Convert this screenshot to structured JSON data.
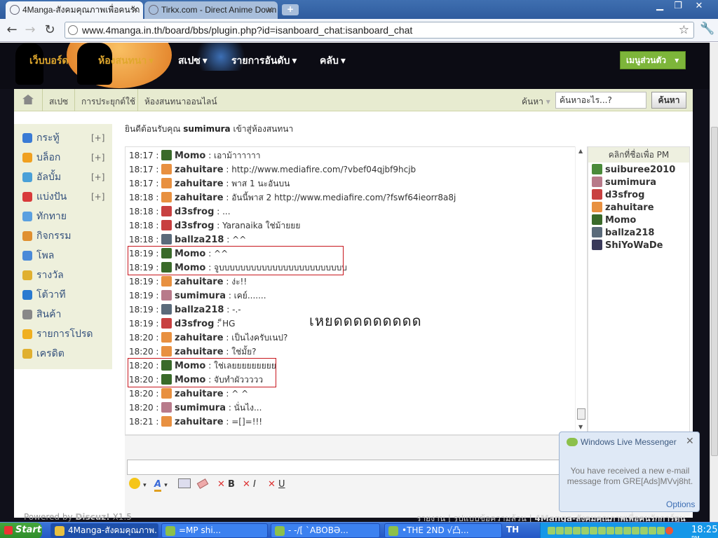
{
  "browser": {
    "tabs": [
      {
        "label": "4Manga-สังคมคุณภาพเพื่อคนรัก",
        "active": true
      },
      {
        "label": "Tirkx.com - Direct Anime Down",
        "active": false
      }
    ],
    "url": "www.4manga.in.th/board/bbs/plugin.php?id=isanboard_chat:isanboard_chat",
    "nav_icons": [
      "back-icon",
      "forward-icon",
      "reload-icon",
      "star-icon",
      "wrench-icon"
    ]
  },
  "site": {
    "main_nav": [
      {
        "label": "เว็บบอร์ด",
        "color": "#e0a82e",
        "dropdown": false
      },
      {
        "label": "ห้องสนทนา",
        "color": "#e0a82e",
        "dropdown": true
      },
      {
        "label": "สเปซ",
        "color": "#ffffff",
        "dropdown": true
      },
      {
        "label": "รายการอันดับ",
        "color": "#ffffff",
        "dropdown": true
      },
      {
        "label": "คลับ",
        "color": "#ffffff",
        "dropdown": true
      }
    ],
    "my_menu": "เมนูส่วนตัว",
    "breadcrumb": [
      "สเปซ",
      "การประยุกต์ใช้",
      "ห้องสนทนาออนไลน์"
    ],
    "search": {
      "type_label": "ค้นหา",
      "placeholder": "ค้นหาอะไร...?",
      "button": "ค้นหา"
    },
    "sidebar": [
      {
        "label": "กระทู้",
        "plus": "[+]",
        "icon": "thread-icon",
        "color": "#3a7bd5"
      },
      {
        "label": "บล็อก",
        "plus": "[+]",
        "icon": "blog-icon",
        "color": "#f0a020"
      },
      {
        "label": "อัลบั้ม",
        "plus": "[+]",
        "icon": "album-icon",
        "color": "#4aa0d8"
      },
      {
        "label": "แบ่งปัน",
        "plus": "[+]",
        "icon": "share-icon",
        "color": "#d83a3a"
      },
      {
        "label": "ทักทาย",
        "plus": "",
        "icon": "greet-icon",
        "color": "#5aa0e0"
      },
      {
        "label": "กิจกรรม",
        "plus": "",
        "icon": "activity-icon",
        "color": "#e09030"
      },
      {
        "label": "โพล",
        "plus": "",
        "icon": "poll-icon",
        "color": "#4a8ad8"
      },
      {
        "label": "รางวัล",
        "plus": "",
        "icon": "reward-icon",
        "color": "#e0b030"
      },
      {
        "label": "โต้วาที",
        "plus": "",
        "icon": "debate-icon",
        "color": "#2a7ad0"
      },
      {
        "label": "สินค้า",
        "plus": "",
        "icon": "goods-icon",
        "color": "#888888"
      },
      {
        "label": "รายการโปรด",
        "plus": "",
        "icon": "favorite-icon",
        "color": "#f0b020"
      },
      {
        "label": "เครดิต",
        "plus": "",
        "icon": "credit-icon",
        "color": "#e0b030"
      }
    ],
    "welcome": {
      "prefix": "ยินดีต้อนรับคุณ",
      "user": "sumimura",
      "suffix": "เข้าสู่ห้องสนทนา"
    },
    "chat": [
      {
        "time": "18:17 :",
        "user": "Momo",
        "text": ": เอาม้าาาาาา",
        "avatar_color": "#3a6a2a"
      },
      {
        "time": "18:17 :",
        "user": "zahuitare",
        "text": ": http://www.mediafire.com/?vbef04qjbf9hcjb",
        "avatar_color": "#e89040"
      },
      {
        "time": "18:17 :",
        "user": "zahuitare",
        "text": ": พาส 1 นะอันบน",
        "avatar_color": "#e89040"
      },
      {
        "time": "18:18 :",
        "user": "zahuitare",
        "text": ": อันนี้พาส 2 http://www.mediafire.com/?fswf64ieorr8a8j",
        "avatar_color": "#e89040"
      },
      {
        "time": "18:18 :",
        "user": "d3sfrog",
        "text": ": ...",
        "avatar_color": "#c84040"
      },
      {
        "time": "18:18 :",
        "user": "d3sfrog",
        "text": ": Yaranaika ใช่ม้ายยย",
        "avatar_color": "#c84040"
      },
      {
        "time": "18:18 :",
        "user": "ballza218",
        "text": ": ^^",
        "avatar_color": "#5a6a7a"
      },
      {
        "time": "18:19 :",
        "user": "Momo",
        "text": ": ^^",
        "avatar_color": "#3a6a2a"
      },
      {
        "time": "18:19 :",
        "user": "Momo",
        "text": ": จูบบบบบบบบบบบบบบบบบบบบบบบบ",
        "avatar_color": "#3a6a2a"
      },
      {
        "time": "18:19 :",
        "user": "zahuitare",
        "text": ": ง่ะ!!",
        "avatar_color": "#e89040"
      },
      {
        "time": "18:19 :",
        "user": "sumimura",
        "text": ": เคย์.......",
        "avatar_color": "#b87a8a"
      },
      {
        "time": "18:19 :",
        "user": "ballza218",
        "text": ": -.-",
        "avatar_color": "#5a6a7a"
      },
      {
        "time": "18:19 :",
        "user": "d3sfrog",
        "text": ": ็HG",
        "avatar_color": "#c84040"
      },
      {
        "time": "18:20 :",
        "user": "zahuitare",
        "text": ": เป็นไงครับเนป?",
        "avatar_color": "#e89040"
      },
      {
        "time": "18:20 :",
        "user": "zahuitare",
        "text": ": ใช่มั้ย?",
        "avatar_color": "#e89040"
      },
      {
        "time": "18:20 :",
        "user": "Momo",
        "text": ": ใช่เลยยยยยยยยย",
        "avatar_color": "#3a6a2a"
      },
      {
        "time": "18:20 :",
        "user": "Momo",
        "text": ": จับทำผัววววว",
        "avatar_color": "#3a6a2a"
      },
      {
        "time": "18:20 :",
        "user": "zahuitare",
        "text": ": ^ ^",
        "avatar_color": "#e89040"
      },
      {
        "time": "18:20 :",
        "user": "sumimura",
        "text": ": นั่นไง...",
        "avatar_color": "#b87a8a"
      },
      {
        "time": "18:21 :",
        "user": "zahuitare",
        "text": ": =[]=!!!",
        "avatar_color": "#e89040"
      }
    ],
    "overlay_text": "เหยดดดดดดดดด",
    "online_panel": {
      "title": "คลิกที่ชื่อเพื่อ PM",
      "users": [
        {
          "name": "suiburee2010",
          "avatar_color": "#4a8a3a"
        },
        {
          "name": "sumimura",
          "avatar_color": "#b87a8a"
        },
        {
          "name": "d3sfrog",
          "avatar_color": "#c84040"
        },
        {
          "name": "zahuitare",
          "avatar_color": "#e89040"
        },
        {
          "name": "Momo",
          "avatar_color": "#3a6a2a"
        },
        {
          "name": "ballza218",
          "avatar_color": "#5a6a7a"
        },
        {
          "name": "ShiYoWaDe",
          "avatar_color": "#3a3a5a"
        }
      ]
    },
    "toolbar_buttons": [
      "smiley-icon",
      "font-color-icon",
      "image-icon",
      "eraser-icon"
    ],
    "format_buttons": [
      {
        "icon": "x-icon",
        "label": "B"
      },
      {
        "icon": "x-icon",
        "label": "I"
      },
      {
        "icon": "x-icon",
        "label": "U"
      }
    ],
    "footer": {
      "prefix": "Powered by",
      "brand": "Discuz!",
      "version": "X1.5"
    },
    "footer_links": [
      "รายงาน",
      "รูปแบบข้อความล้วน",
      "4Manga-สังคมคุณภาพเพื่อคนรักการ์ตูน"
    ]
  },
  "messenger_popup": {
    "title": "Windows Live Messenger",
    "body": "You have received a new e-mail message from GRE[Ads]MVvj8ht.",
    "options": "Options"
  },
  "taskbar": {
    "start": "Start",
    "tasks": [
      {
        "label": "4Manga-สังคมคุณภาพ...",
        "active": true
      },
      {
        "label": "=MP shi...",
        "active": false
      },
      {
        "label": "- -/[ `ABOBƏ...",
        "active": false
      },
      {
        "label": "•THE 2ND √凸...",
        "active": false
      }
    ],
    "language": "TH",
    "clock": "18:25",
    "clock_period": "PM"
  }
}
